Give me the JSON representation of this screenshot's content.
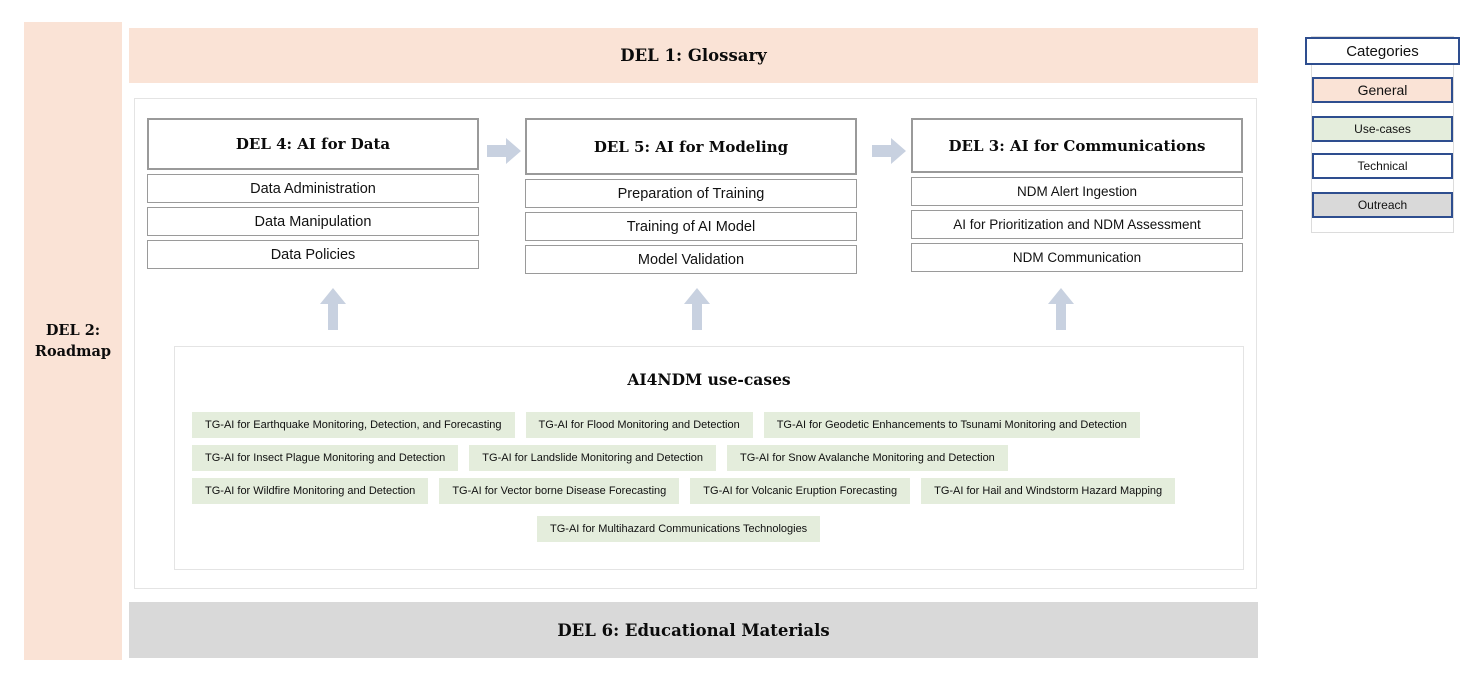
{
  "diagram": {
    "del1_banner": {
      "label": "DEL 1: Glossary"
    },
    "del2_sidebar": {
      "label": "DEL 2:\nRoadmap",
      "line1": "DEL 2:",
      "line2": "Roadmap"
    },
    "del6_banner": {
      "label": "DEL 6: Educational Materials"
    },
    "pillars": [
      {
        "id": "data",
        "title": "DEL 4: AI for Data",
        "items": [
          "Data Administration",
          "Data Manipulation",
          "Data Policies"
        ]
      },
      {
        "id": "modeling",
        "title": "DEL 5: AI for Modeling",
        "items": [
          "Preparation of Training",
          "Training of AI Model",
          "Model Validation"
        ]
      },
      {
        "id": "communications",
        "title": "DEL 3: AI for Communications",
        "items": [
          "NDM Alert Ingestion",
          "AI for Prioritization and NDM Assessment",
          "NDM Communication"
        ]
      }
    ],
    "usecases": {
      "title": "AI4NDM use-cases",
      "rows": [
        [
          "TG-AI for Earthquake Monitoring, Detection, and Forecasting",
          "TG-AI for Flood Monitoring and Detection",
          "TG-AI for Geodetic Enhancements to Tsunami Monitoring and Detection"
        ],
        [
          "TG-AI for Insect Plague Monitoring and Detection",
          "TG-AI for Landslide Monitoring and Detection",
          "TG-AI for Snow Avalanche Monitoring and Detection"
        ],
        [
          "TG-AI for Wildfire Monitoring and Detection",
          "TG-AI for Vector borne Disease Forecasting",
          "TG-AI for Volcanic Eruption Forecasting",
          "TG-AI for Hail and Windstorm Hazard Mapping"
        ],
        [
          "TG-AI for Multihazard Communications Technologies"
        ]
      ]
    },
    "legend": {
      "title": "Categories",
      "items": [
        {
          "label": "General",
          "color": "#FAE3D6"
        },
        {
          "label": "Use-cases",
          "color": "#E4EDDC"
        },
        {
          "label": "Technical",
          "color": "#FFFFFF"
        },
        {
          "label": "Outreach",
          "color": "#D9D9D9"
        }
      ]
    },
    "arrows": {
      "color": "#C8D1E0",
      "horizontal": [
        "data-to-modeling",
        "modeling-to-communications"
      ],
      "vertical": [
        "usecases-to-data",
        "usecases-to-modeling",
        "usecases-to-communications"
      ]
    }
  }
}
